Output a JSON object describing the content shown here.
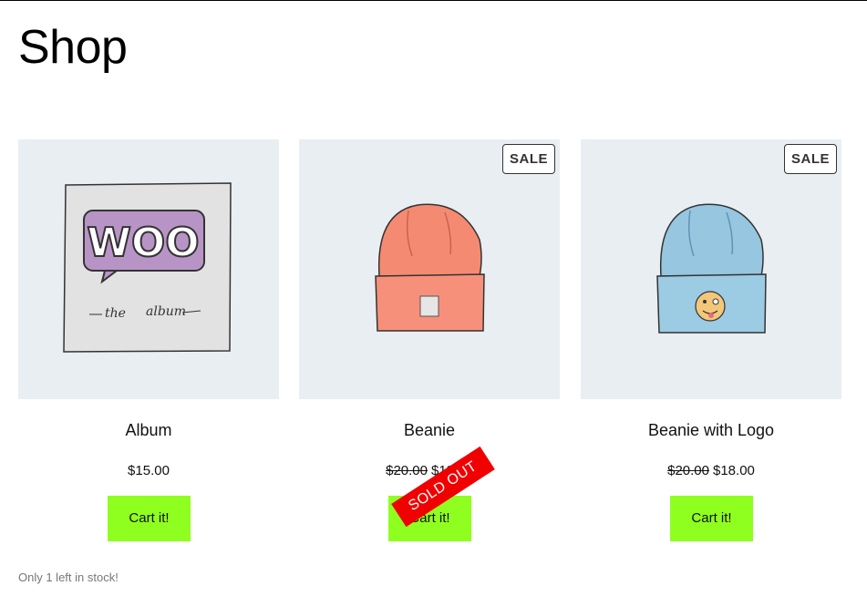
{
  "page": {
    "title": "Shop"
  },
  "products": [
    {
      "name": "Album",
      "price": "$15.00",
      "old_price": "",
      "button_label": "Cart it!",
      "sale_badge": ""
    },
    {
      "name": "Beanie",
      "price": "$18.00",
      "old_price": "$20.00",
      "button_label": "Cart it!",
      "sale_badge": "SALE",
      "sold_out_label": "SOLD OUT"
    },
    {
      "name": "Beanie with Logo",
      "price": "$18.00",
      "old_price": "$20.00",
      "button_label": "Cart it!",
      "sale_badge": "SALE"
    }
  ],
  "album_art": {
    "logo_text": "WOO",
    "caption_left": "the",
    "caption_right": "album"
  },
  "stock_note": "Only 1 left in stock!",
  "colors": {
    "button": "#8fff1f",
    "sold_out": "#f00000",
    "image_bg": "#e9eef2"
  },
  "icons": [
    "album-image",
    "beanie-image",
    "beanie-logo-image"
  ]
}
